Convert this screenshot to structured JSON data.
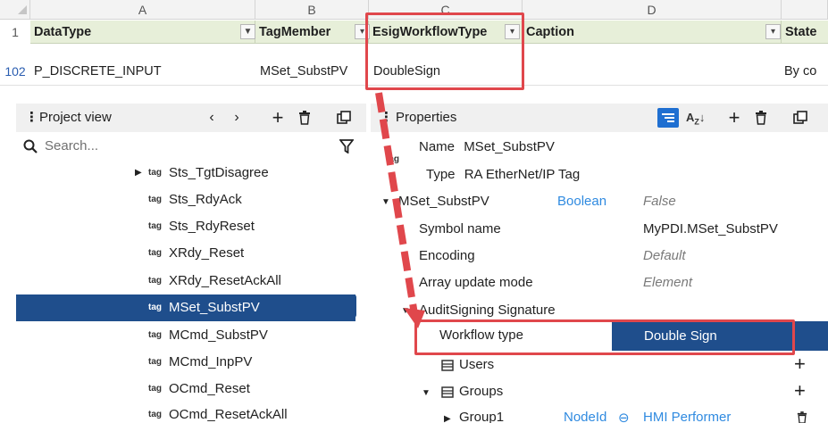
{
  "sheet": {
    "col_letters": [
      "A",
      "B",
      "C",
      "D"
    ],
    "header_row_num": "1",
    "headers": [
      "DataType",
      "TagMember",
      "EsigWorkflowType",
      "Caption",
      "State"
    ],
    "data_row_num": "102",
    "values": [
      "P_DISCRETE_INPUT",
      "MSet_SubstPV",
      "DoubleSign",
      "By co"
    ]
  },
  "project_view": {
    "title": "Project view",
    "search_placeholder": "Search...",
    "tag_prefix": "tag",
    "items": [
      {
        "label": "Sts_TgtDisagree",
        "expandable": true
      },
      {
        "label": "Sts_RdyAck"
      },
      {
        "label": "Sts_RdyReset"
      },
      {
        "label": "XRdy_Reset"
      },
      {
        "label": "XRdy_ResetAckAll"
      },
      {
        "label": "MSet_SubstPV",
        "selected": true
      },
      {
        "label": "MCmd_SubstPV"
      },
      {
        "label": "MCmd_InpPV"
      },
      {
        "label": "OCmd_Reset"
      },
      {
        "label": "OCmd_ResetAckAll"
      }
    ]
  },
  "properties": {
    "title": "Properties",
    "tag_icon": "tag",
    "name_label": "Name",
    "name_value": "MSet_SubstPV",
    "type_label": "Type",
    "type_value": "RA EtherNet/IP Tag",
    "member": {
      "name": "MSet_SubstPV",
      "type": "Boolean",
      "value": "False"
    },
    "rows": [
      {
        "label": "Symbol name",
        "value": "MyPDI.MSet_SubstPV"
      },
      {
        "label": "Encoding",
        "value": "Default"
      },
      {
        "label": "Array update mode",
        "value": "Element"
      }
    ],
    "audit_group": "AuditSigning Signature",
    "workflow_label": "Workflow type",
    "workflow_value": "Double Sign",
    "users_label": "Users",
    "groups_label": "Groups",
    "group1": {
      "name": "Group1",
      "type": "NodeId",
      "value": "HMI Performer"
    }
  },
  "colors": {
    "selection": "#1f4e8c",
    "highlight": "#e0474c",
    "header_fill": "#e7efd9",
    "link_blue": "#2f8ae0"
  }
}
